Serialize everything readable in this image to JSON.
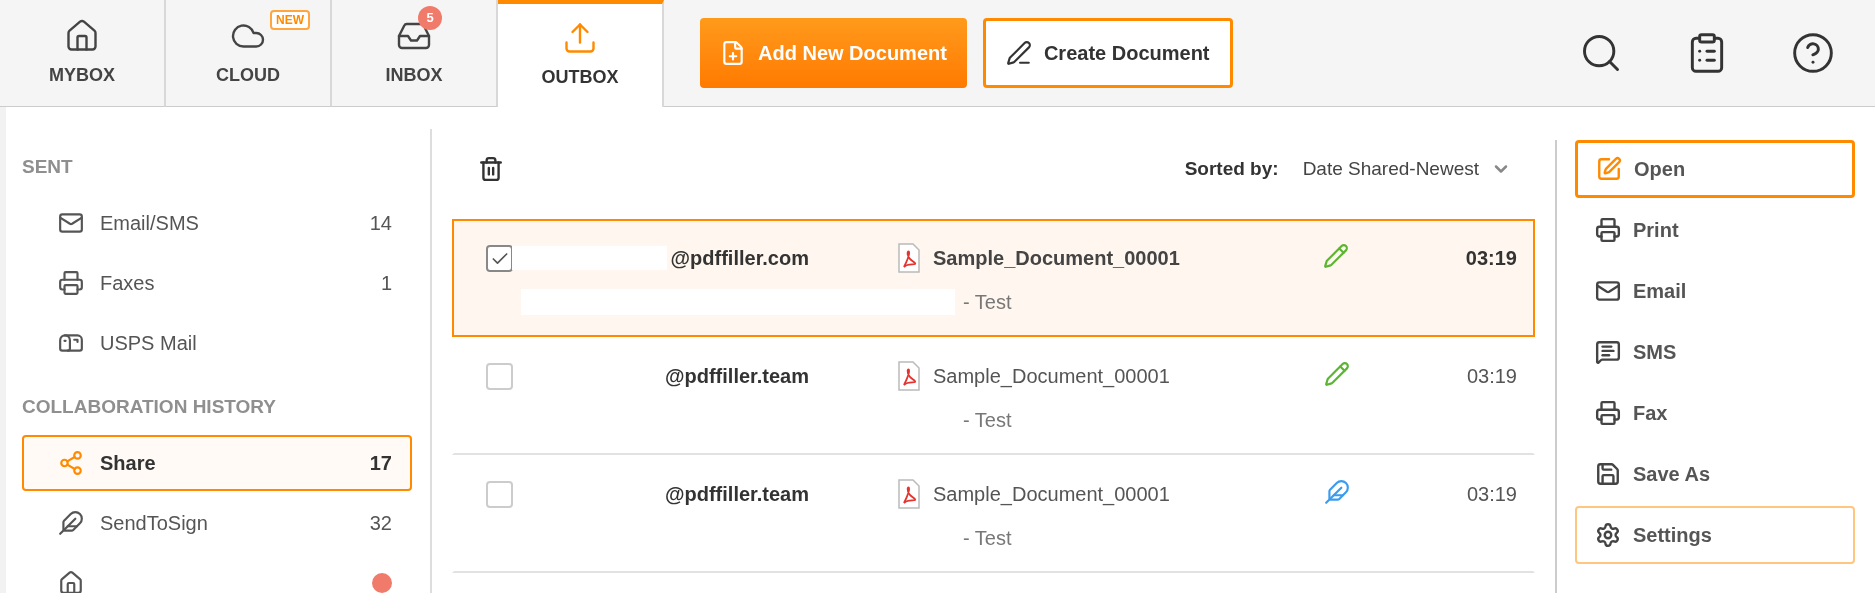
{
  "tabs": [
    {
      "label": "MYBOX",
      "selected": false
    },
    {
      "label": "CLOUD",
      "selected": false,
      "badge": "NEW"
    },
    {
      "label": "INBOX",
      "selected": false,
      "count": "5"
    },
    {
      "label": "OUTBOX",
      "selected": true
    }
  ],
  "actions": [
    {
      "label": "Add New Document",
      "kind": "primary"
    },
    {
      "label": "Create Document",
      "kind": "outline"
    }
  ],
  "sidebar": [
    {
      "title": "SENT",
      "items": [
        {
          "label": "Email/SMS",
          "count": "14",
          "selected": false
        },
        {
          "label": "Faxes",
          "count": "1",
          "selected": false
        },
        {
          "label": "USPS Mail",
          "selected": false
        }
      ]
    },
    {
      "title": "COLLABORATION HISTORY",
      "items": [
        {
          "label": "Share",
          "count": "17",
          "selected": true
        },
        {
          "label": "SendToSign",
          "count": "32",
          "selected": false
        },
        {
          "partial": true,
          "selected": false
        }
      ]
    }
  ],
  "sort": {
    "label": "Sorted by:",
    "value": "Date Shared-Newest"
  },
  "rows": [
    {
      "checked": true,
      "selected": true,
      "redacted": true,
      "sender": "@pdffiller.com",
      "document": "Sample_Document_00001",
      "note": "- Test",
      "kind": "edit",
      "time": "03:19"
    },
    {
      "checked": false,
      "selected": false,
      "redacted": false,
      "sender": "@pdffiller.team",
      "document": "Sample_Document_00001",
      "note": "- Test",
      "kind": "edit",
      "time": "03:19"
    },
    {
      "checked": false,
      "selected": false,
      "redacted": false,
      "sender": "@pdffiller.team",
      "document": "Sample_Document_00001",
      "note": "- Test",
      "kind": "sign",
      "time": "03:19"
    }
  ],
  "panel": [
    {
      "label": "Open",
      "selected": true,
      "outlined": false
    },
    {
      "label": "Print",
      "selected": false,
      "outlined": false
    },
    {
      "label": "Email",
      "selected": false,
      "outlined": false
    },
    {
      "label": "SMS",
      "selected": false,
      "outlined": false
    },
    {
      "label": "Fax",
      "selected": false,
      "outlined": false
    },
    {
      "label": "Save As",
      "selected": false,
      "outlined": false
    },
    {
      "label": "Settings",
      "selected": false,
      "outlined": true
    }
  ]
}
